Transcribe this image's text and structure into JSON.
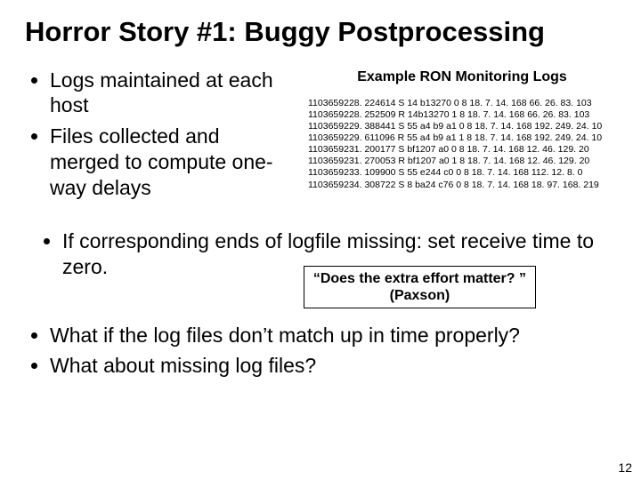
{
  "title": "Horror Story #1: Buggy Postprocessing",
  "left_bullets": [
    "Logs maintained at each host",
    "Files collected and merged to compute one-way delays"
  ],
  "right_heading": "Example RON Monitoring Logs",
  "log_lines": [
    "1103659228. 224614 S 14 b13270 0 8 18. 7. 14. 168 66. 26. 83. 103",
    "1103659228. 252509 R 14b13270 1 8 18. 7. 14. 168 66. 26. 83. 103",
    "1103659229. 388441 S 55 a4 b9 a1 0 8 18. 7. 14. 168 192. 249. 24. 10",
    "1103659229. 611096 R 55 a4 b9 a1 1 8 18. 7. 14. 168 192. 249. 24. 10",
    "1103659231. 200177 S bf1207 a0 0 8 18. 7. 14. 168 12. 46. 129. 20",
    "1103659231. 270053 R bf1207 a0 1 8 18. 7. 14. 168 12. 46. 129. 20",
    "1103659233. 109900 S 55 e244 c0 0 8 18. 7. 14. 168 112. 12. 8. 0",
    "1103659234. 308722 S 8 ba24 c76 0 8 18. 7. 14. 168 18. 97. 168. 219"
  ],
  "mid_bullet": "If corresponding ends of logfile missing: set receive time to zero.",
  "quote_line1": "“Does the extra effort matter? ”",
  "quote_line2": "(Paxson)",
  "bottom_bullets": [
    "What if the log files don’t match up in time properly?",
    "What about missing log files?"
  ],
  "page_number": "12"
}
